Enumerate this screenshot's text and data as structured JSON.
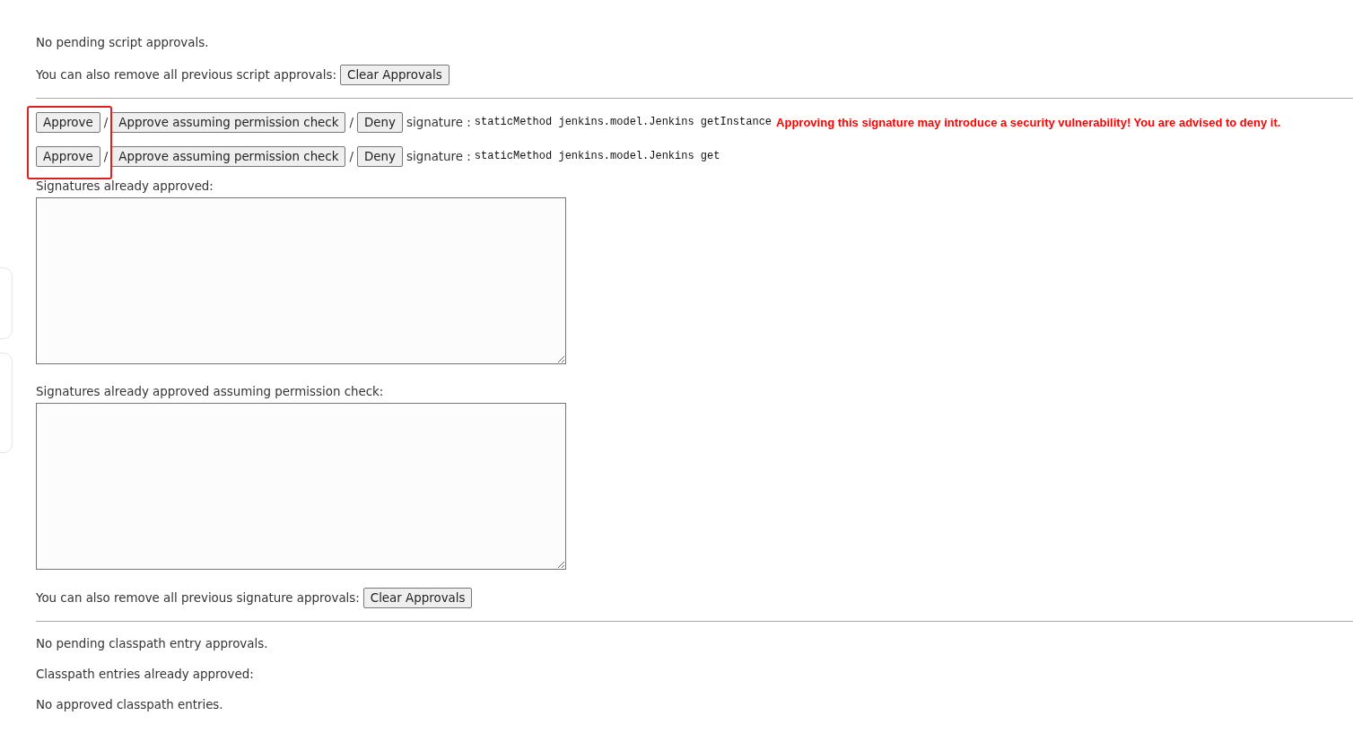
{
  "script_approvals": {
    "pending_text": "No pending script approvals.",
    "clear_label": "You can also remove all previous script approvals:",
    "clear_button": "Clear Approvals"
  },
  "signatures": {
    "pending": [
      {
        "approve": "Approve",
        "approve_check": "Approve assuming permission check",
        "deny": "Deny",
        "separator": "/",
        "prefix": "signature :",
        "signature": "staticMethod jenkins.model.Jenkins getInstance",
        "warning": "Approving this signature may introduce a security vulnerability! You are advised to deny it."
      },
      {
        "approve": "Approve",
        "approve_check": "Approve assuming permission check",
        "deny": "Deny",
        "separator": "/",
        "prefix": "signature :",
        "signature": "staticMethod jenkins.model.Jenkins get"
      }
    ],
    "approved_label": "Signatures already approved:",
    "approved_check_label": "Signatures already approved assuming permission check:",
    "clear_label": "You can also remove all previous signature approvals:",
    "clear_button": "Clear Approvals"
  },
  "classpath": {
    "pending_text": "No pending classpath entry approvals.",
    "approved_label": "Classpath entries already approved:",
    "approved_text": "No approved classpath entries."
  }
}
